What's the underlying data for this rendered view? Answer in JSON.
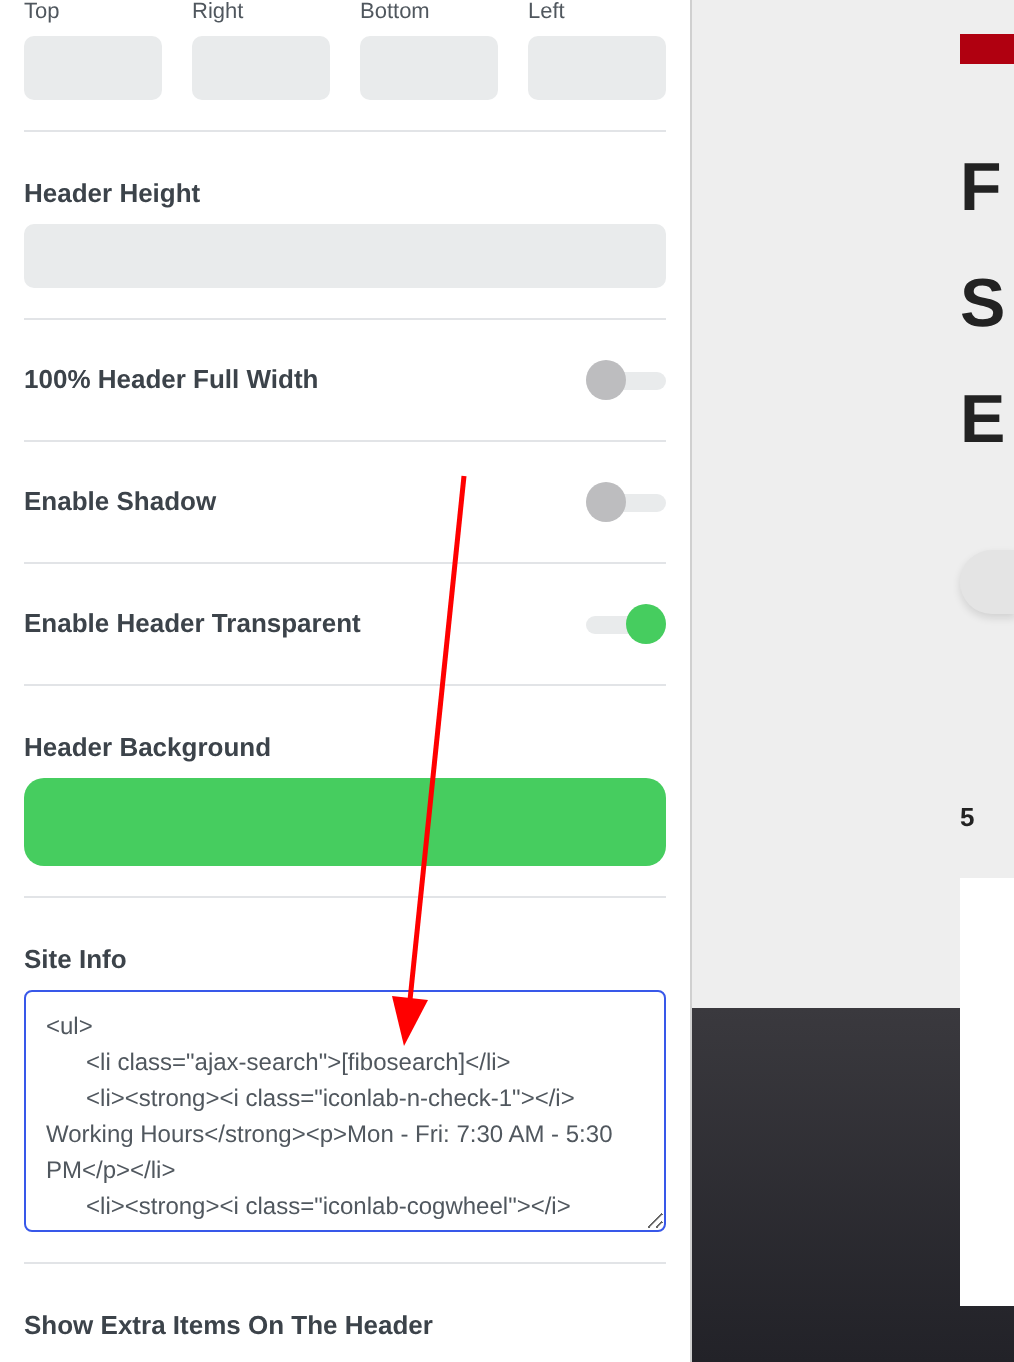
{
  "padding": {
    "fields": [
      {
        "label": "Top"
      },
      {
        "label": "Right"
      },
      {
        "label": "Bottom"
      },
      {
        "label": "Left"
      }
    ]
  },
  "header_height": {
    "label": "Header Height"
  },
  "toggles": [
    {
      "label": "100% Header Full Width",
      "on": false
    },
    {
      "label": "Enable Shadow",
      "on": false
    },
    {
      "label": "Enable Header Transparent",
      "on": true
    }
  ],
  "header_background": {
    "label": "Header Background",
    "color": "#46cd5f"
  },
  "site_info": {
    "label": "Site Info",
    "value": "<ul>\n\t<li class=\"ajax-search\">[fibosearch]</li>\n\t<li><strong><i class=\"iconlab-n-check-1\"></i> Working Hours</strong><p>Mon - Fri: 7:30 AM - 5:30 PM</p></li>\n\t<li><strong><i class=\"iconlab-cogwheel\"></i>"
  },
  "next_section": {
    "label": "Show Extra Items On The Header"
  },
  "preview": {
    "headline_letters": [
      "F",
      "S",
      "E"
    ],
    "number": "5"
  }
}
